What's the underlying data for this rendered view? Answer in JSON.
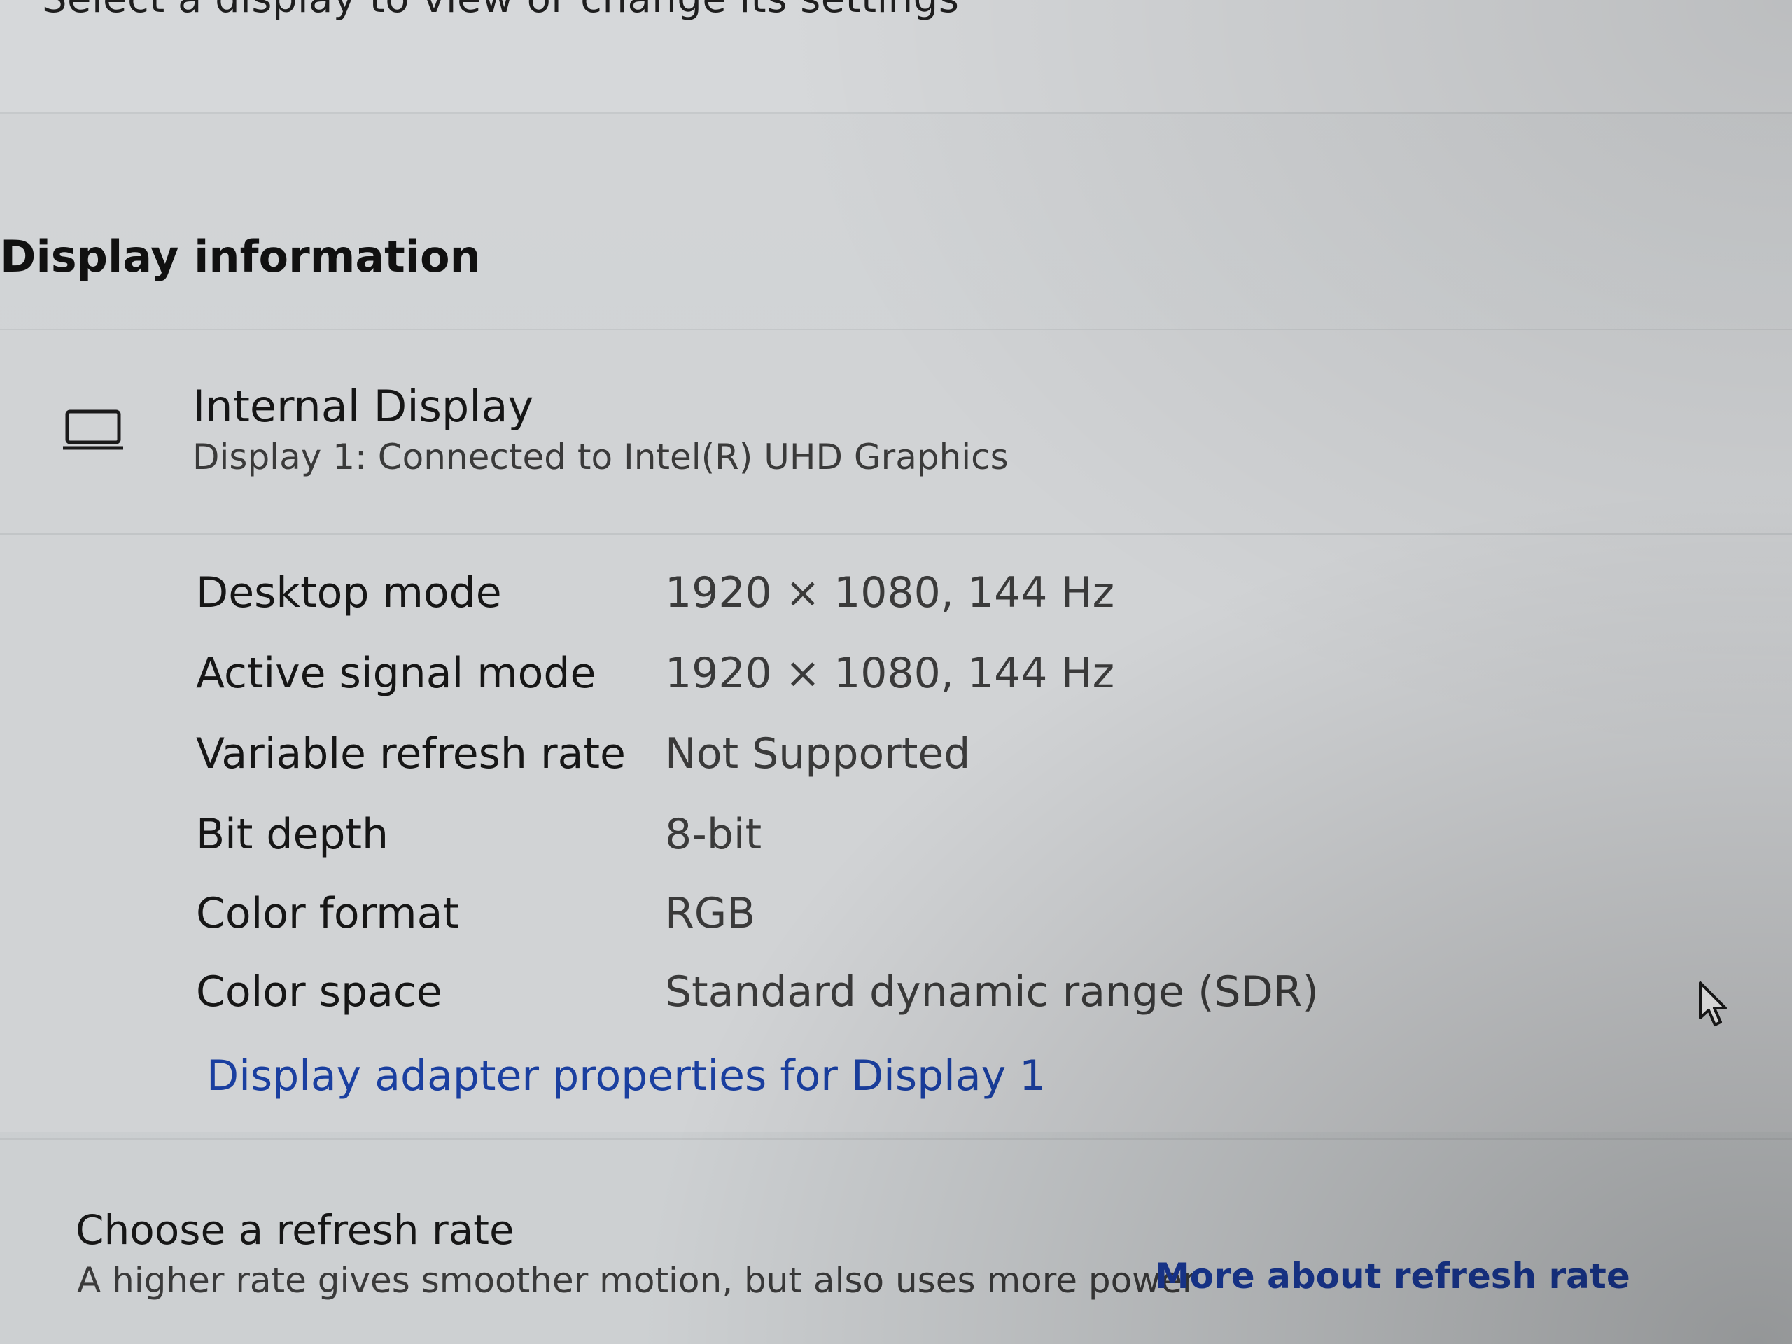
{
  "header": {
    "subtitle": "Select a display to view or change its settings"
  },
  "display_information": {
    "heading": "Display information",
    "display": {
      "icon": "laptop-display-icon",
      "name": "Internal Display",
      "connection": "Display 1: Connected to Intel(R) UHD Graphics"
    },
    "rows": [
      {
        "label": "Desktop mode",
        "value": "1920 × 1080, 144 Hz"
      },
      {
        "label": "Active signal mode",
        "value": "1920 × 1080, 144 Hz"
      },
      {
        "label": "Variable refresh rate",
        "value": "Not Supported"
      },
      {
        "label": "Bit depth",
        "value": "8-bit"
      },
      {
        "label": "Color format",
        "value": "RGB"
      },
      {
        "label": "Color space",
        "value": "Standard dynamic range (SDR)"
      }
    ],
    "adapter_link": "Display adapter properties for Display 1"
  },
  "refresh_rate": {
    "title": "Choose a refresh rate",
    "description": "A higher rate gives smoother motion, but also uses more power",
    "link": "More about refresh rate"
  },
  "colors": {
    "link": "#1a3fa0",
    "text_primary": "#161616",
    "text_secondary": "#3a3a3a"
  }
}
